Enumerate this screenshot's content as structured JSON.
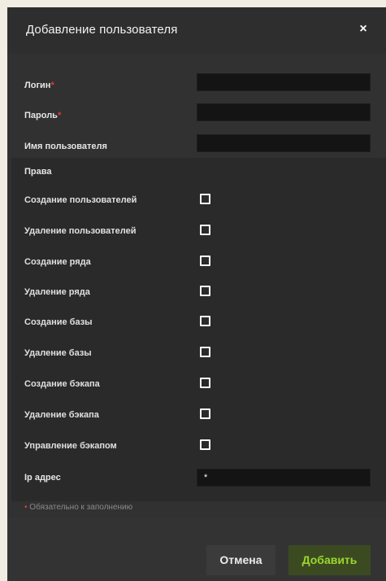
{
  "dialog": {
    "title": "Добавление пользователя",
    "close_label": "×"
  },
  "fields": {
    "login": {
      "label": "Логин",
      "required_mark": "*",
      "value": ""
    },
    "password": {
      "label": "Пароль",
      "required_mark": "*",
      "value": ""
    },
    "username": {
      "label": "Имя пользователя",
      "value": ""
    }
  },
  "rights": {
    "title": "Права",
    "items": [
      {
        "label": "Создание пользователей",
        "checked": false
      },
      {
        "label": "Удаление пользователей",
        "checked": false
      },
      {
        "label": "Создание ряда",
        "checked": false
      },
      {
        "label": "Удаление ряда",
        "checked": false
      },
      {
        "label": "Создание базы",
        "checked": false
      },
      {
        "label": "Удаление базы",
        "checked": false
      },
      {
        "label": "Создание бэкапа",
        "checked": false
      },
      {
        "label": "Удаление бэкапа",
        "checked": false
      },
      {
        "label": "Управление бэкапом",
        "checked": false
      }
    ],
    "ip": {
      "label": "Ip адрес",
      "value": "*"
    }
  },
  "required_note": {
    "mark": "•",
    "text": "Обязательно к заполнению"
  },
  "footer": {
    "cancel_label": "Отмена",
    "add_label": "Добавить"
  },
  "colors": {
    "dialog_bg": "#323232",
    "input_bg": "#141414",
    "required": "#e53935",
    "add_button_text": "#9ad82c",
    "add_button_bg": "#3c4a22"
  }
}
